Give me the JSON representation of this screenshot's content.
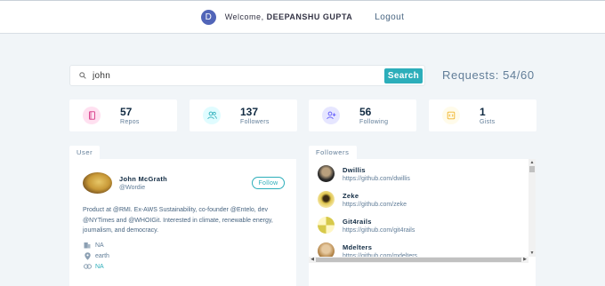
{
  "header": {
    "avatar_initial": "D",
    "welcome_text": "Welcome,",
    "username": "DEEPANSHU GUPTA",
    "logout_label": "Logout"
  },
  "search": {
    "value": "john",
    "button_label": "Search",
    "requests_text": "Requests: 54/60"
  },
  "stats": [
    {
      "value": "57",
      "label": "Repos",
      "icon": "book-icon",
      "bg": "#ffe0f0",
      "color": "#da4a91"
    },
    {
      "value": "137",
      "label": "Followers",
      "icon": "users-icon",
      "bg": "#e0fcff",
      "color": "#2caeba"
    },
    {
      "value": "56",
      "label": "Following",
      "icon": "user-plus-icon",
      "bg": "#e6e6ff",
      "color": "#5d55fa"
    },
    {
      "value": "1",
      "label": "Gists",
      "icon": "code-icon",
      "bg": "#fffbea",
      "color": "#f0b429"
    }
  ],
  "user_card": {
    "tab_label": "User",
    "name": "John McGrath",
    "handle": "@Wordie",
    "follow_label": "Follow",
    "bio": "Product at @RMI. Ex-AWS Sustainability, co-founder @Entelo, dev @NYTimes and @WHOIGit. Interested in climate, renewable energy, journalism, and democracy.",
    "company": "NA",
    "location": "earth",
    "blog": "NA"
  },
  "followers_card": {
    "tab_label": "Followers",
    "items": [
      {
        "login": "Dwillis",
        "url": "https://github.com/dwillis"
      },
      {
        "login": "Zeke",
        "url": "https://github.com/zeke"
      },
      {
        "login": "Git4rails",
        "url": "https://github.com/git4rails"
      },
      {
        "login": "Mdelters",
        "url": "https://github.com/mdelters"
      }
    ]
  },
  "colors": {
    "accent": "#2caeba",
    "background": "#f1f5f8",
    "avatar": "#5165b8"
  }
}
